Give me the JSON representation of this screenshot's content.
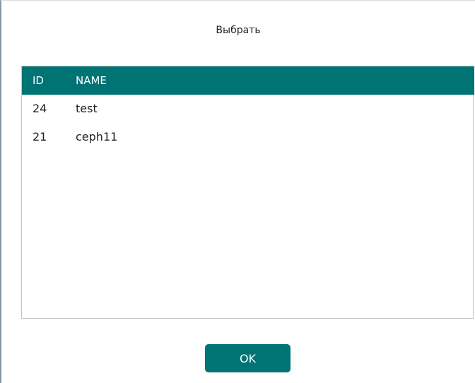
{
  "dialog": {
    "title": "Выбрать",
    "ok_label": "OK"
  },
  "table": {
    "columns": {
      "id": "ID",
      "name": "NAME"
    },
    "rows": [
      {
        "id": "24",
        "name": "test"
      },
      {
        "id": "21",
        "name": "ceph11"
      }
    ]
  },
  "colors": {
    "accent": "#007374",
    "border": "#bfc4c7",
    "text": "#222222"
  }
}
